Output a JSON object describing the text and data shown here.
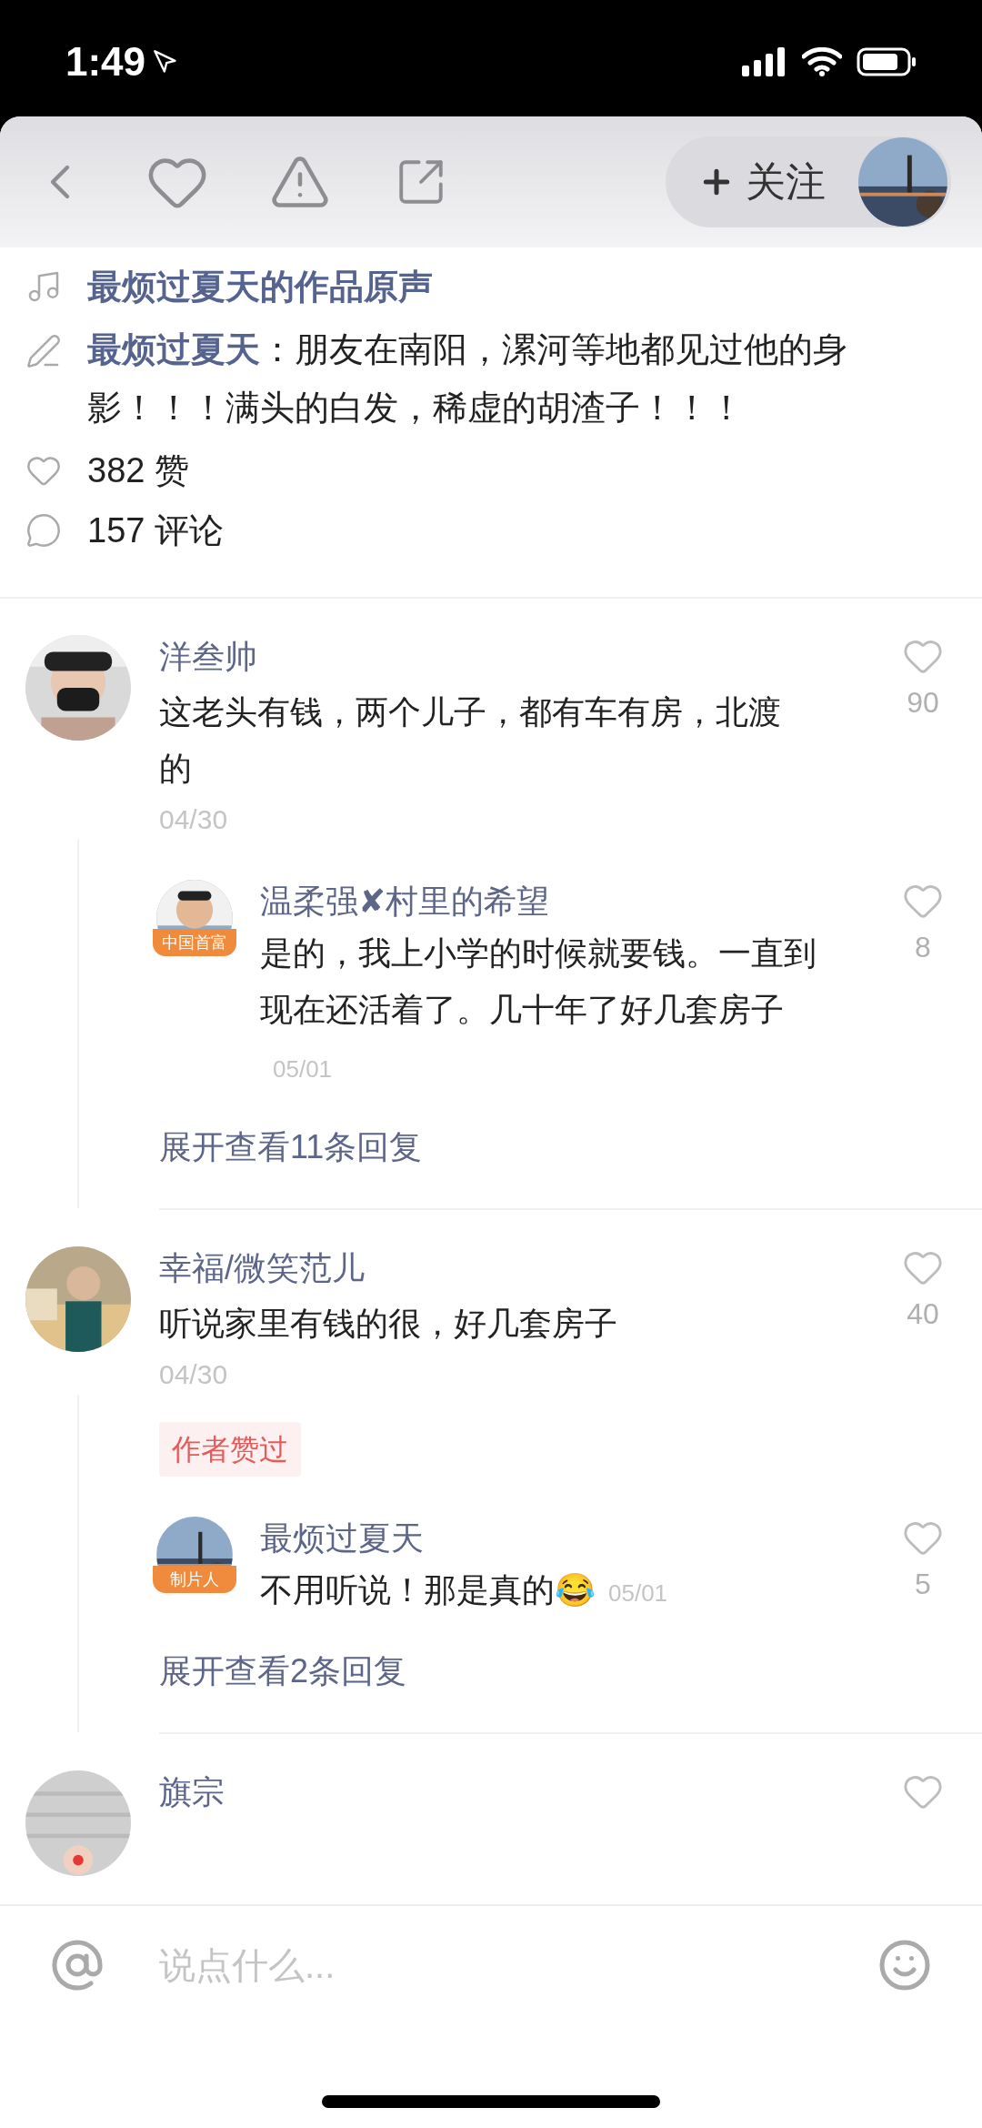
{
  "status_bar": {
    "time": "1:49"
  },
  "toolbar": {
    "follow_button": "关注"
  },
  "post": {
    "sound": "最烦过夏天的作品原声",
    "caption_author": "最烦过夏天",
    "caption": "：朋友在南阳，漯河等地都见过他的身影！！！满头的白发，稀虚的胡渣子！！！",
    "likes": "382 赞",
    "comments": "157 评论"
  },
  "comments": [
    {
      "name": "洋叁帅",
      "text": "这老头有钱，两个儿子，都有车有房，北渡的",
      "date": "04/30",
      "likes": "90",
      "replies": [
        {
          "name": "温柔强✘村里的希望",
          "badge": "中国首富",
          "text": "是的，我上小学的时候就要钱。一直到现在还活着了。几十年了好几套房子",
          "date": "05/01",
          "likes": "8"
        }
      ],
      "more": "展开查看11条回复"
    },
    {
      "name": "幸福/微笑范儿",
      "text": "听说家里有钱的很，好几套房子",
      "date": "04/30",
      "likes": "40",
      "tag": "作者赞过",
      "replies": [
        {
          "name": "最烦过夏天",
          "badge": "制片人",
          "text": "不用听说！那是真的😂",
          "date": "05/01",
          "likes": "5"
        }
      ],
      "more": "展开查看2条回复"
    },
    {
      "name": "旗宗"
    }
  ],
  "input": {
    "placeholder": "说点什么..."
  }
}
